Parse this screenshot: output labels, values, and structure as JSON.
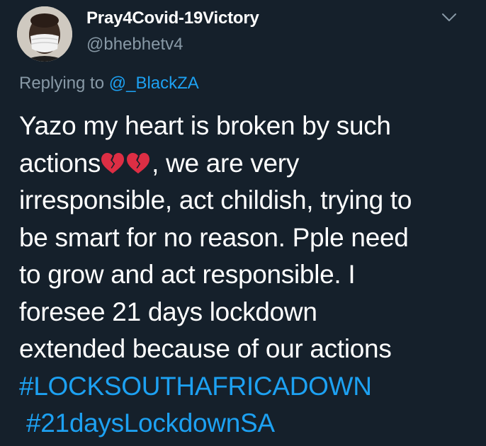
{
  "user": {
    "display_name": "Pray4Covid-19Victory",
    "handle": "@bhebhetv4",
    "avatar_icon": "profile-photo-with-mask"
  },
  "reply": {
    "prefix": "Replying to ",
    "mention": "@_BlackZA"
  },
  "tweet": {
    "lines": [
      "Yazo my heart is broken by such",
      "actions",
      ", we are very",
      "irresponsible, act childish, trying to",
      "be smart for no reason. Pple need",
      "to grow and act responsible. I",
      "foresee 21 days lockdown",
      "extended because of our actions"
    ],
    "emojis": [
      "broken-heart",
      "broken-heart"
    ],
    "hashtags": [
      "#LOCKSOUTHAFRICADOWN",
      "#21daysLockdownSA"
    ]
  },
  "colors": {
    "background": "#15202b",
    "text": "#ffffff",
    "secondary": "#8899a6",
    "accent": "#1da1f2",
    "emoji": "#dd2e44"
  }
}
